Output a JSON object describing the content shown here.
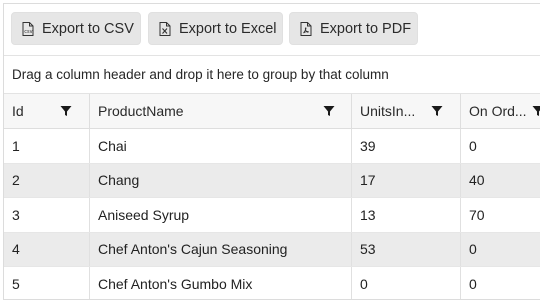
{
  "toolbar": {
    "csv_label": "Export to CSV",
    "excel_label": "Export to Excel",
    "pdf_label": "Export to PDF"
  },
  "group_panel": {
    "hint": "Drag a column header and drop it here to group by that column"
  },
  "columns": [
    {
      "label": "Id"
    },
    {
      "label": "ProductName"
    },
    {
      "label": "UnitsIn..."
    },
    {
      "label": "On Ord..."
    }
  ],
  "rows": [
    {
      "id": "1",
      "product": "Chai",
      "units_in_stock": "39",
      "on_order": "0"
    },
    {
      "id": "2",
      "product": "Chang",
      "units_in_stock": "17",
      "on_order": "40"
    },
    {
      "id": "3",
      "product": "Aniseed Syrup",
      "units_in_stock": "13",
      "on_order": "70"
    },
    {
      "id": "4",
      "product": "Chef Anton's Cajun Seasoning",
      "units_in_stock": "53",
      "on_order": "0"
    },
    {
      "id": "5",
      "product": "Chef Anton's Gumbo Mix",
      "units_in_stock": "0",
      "on_order": "0"
    }
  ],
  "icons": {
    "export_csv": "csv-file-icon",
    "export_excel": "excel-file-icon",
    "export_pdf": "pdf-file-icon",
    "column_filter": "filter-icon"
  }
}
